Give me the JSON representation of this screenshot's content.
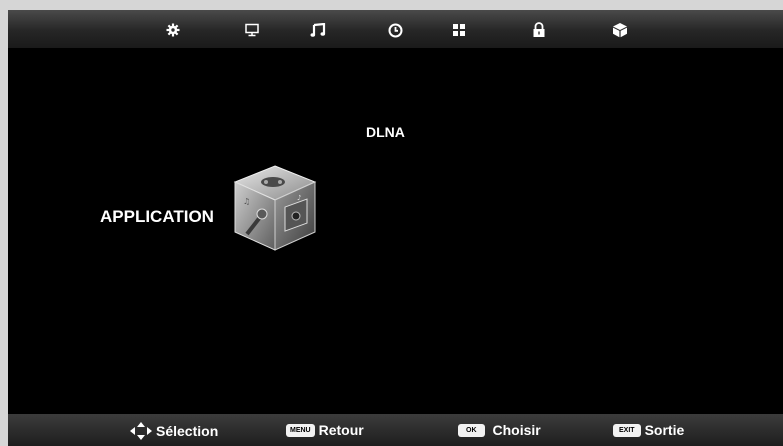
{
  "topbar": {
    "tabs": [
      {
        "icon": "gear-icon"
      },
      {
        "icon": "monitor-icon"
      },
      {
        "icon": "music-note-icon"
      },
      {
        "icon": "clock-icon"
      },
      {
        "icon": "grid-icon"
      },
      {
        "icon": "lock-icon"
      },
      {
        "icon": "cube-icon"
      }
    ]
  },
  "main": {
    "dlna_label": "DLNA",
    "application_label": "APPLICATION"
  },
  "bottombar": {
    "selection_label": "Sélection",
    "menu_key": "MENU",
    "return_label": "Retour",
    "ok_key": "OK",
    "choose_label": "Choisir",
    "exit_key": "EXIT",
    "exit_label": "Sortie"
  }
}
